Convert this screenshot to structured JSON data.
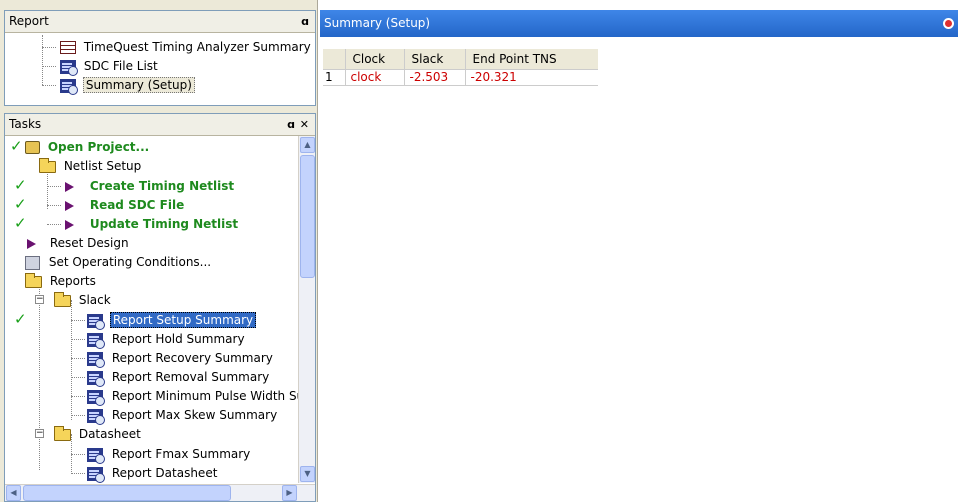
{
  "report_panel": {
    "title": "Report",
    "items": [
      "TimeQuest Timing Analyzer Summary",
      "SDC File List",
      "Summary (Setup)"
    ]
  },
  "tasks_panel": {
    "title": "Tasks",
    "items": {
      "open_project": "Open Project...",
      "netlist_setup": "Netlist Setup",
      "create_timing_netlist": "Create Timing Netlist",
      "read_sdc_file": "Read SDC File",
      "update_timing_netlist": "Update Timing Netlist",
      "reset_design": "Reset Design",
      "set_operating_conditions": "Set Operating Conditions...",
      "reports": "Reports",
      "slack": "Slack",
      "report_setup_summary": "Report Setup Summary",
      "report_hold_summary": "Report Hold Summary",
      "report_recovery_summary": "Report Recovery Summary",
      "report_removal_summary": "Report Removal Summary",
      "report_min_pulse_width": "Report Minimum Pulse Width Sur",
      "report_max_skew_summary": "Report Max Skew Summary",
      "datasheet": "Datasheet",
      "report_fmax_summary": "Report Fmax Summary",
      "report_datasheet": "Report Datasheet"
    }
  },
  "summary_panel": {
    "title": "Summary (Setup)",
    "columns": [
      "Clock",
      "Slack",
      "End Point TNS"
    ],
    "rows": [
      {
        "index": "1",
        "clock": "clock",
        "slack": "-2.503",
        "tns": "-20.321"
      }
    ]
  },
  "colors": {
    "title_bar": "#2b6fd6",
    "green": "#1e8a1e",
    "error_red": "#cc0000",
    "selection": "#316ac5"
  },
  "icons": [
    "pin-icon",
    "close-icon",
    "check-icon",
    "folder-icon",
    "report-icon",
    "table-icon",
    "run-triangle-icon",
    "settings-icon"
  ]
}
